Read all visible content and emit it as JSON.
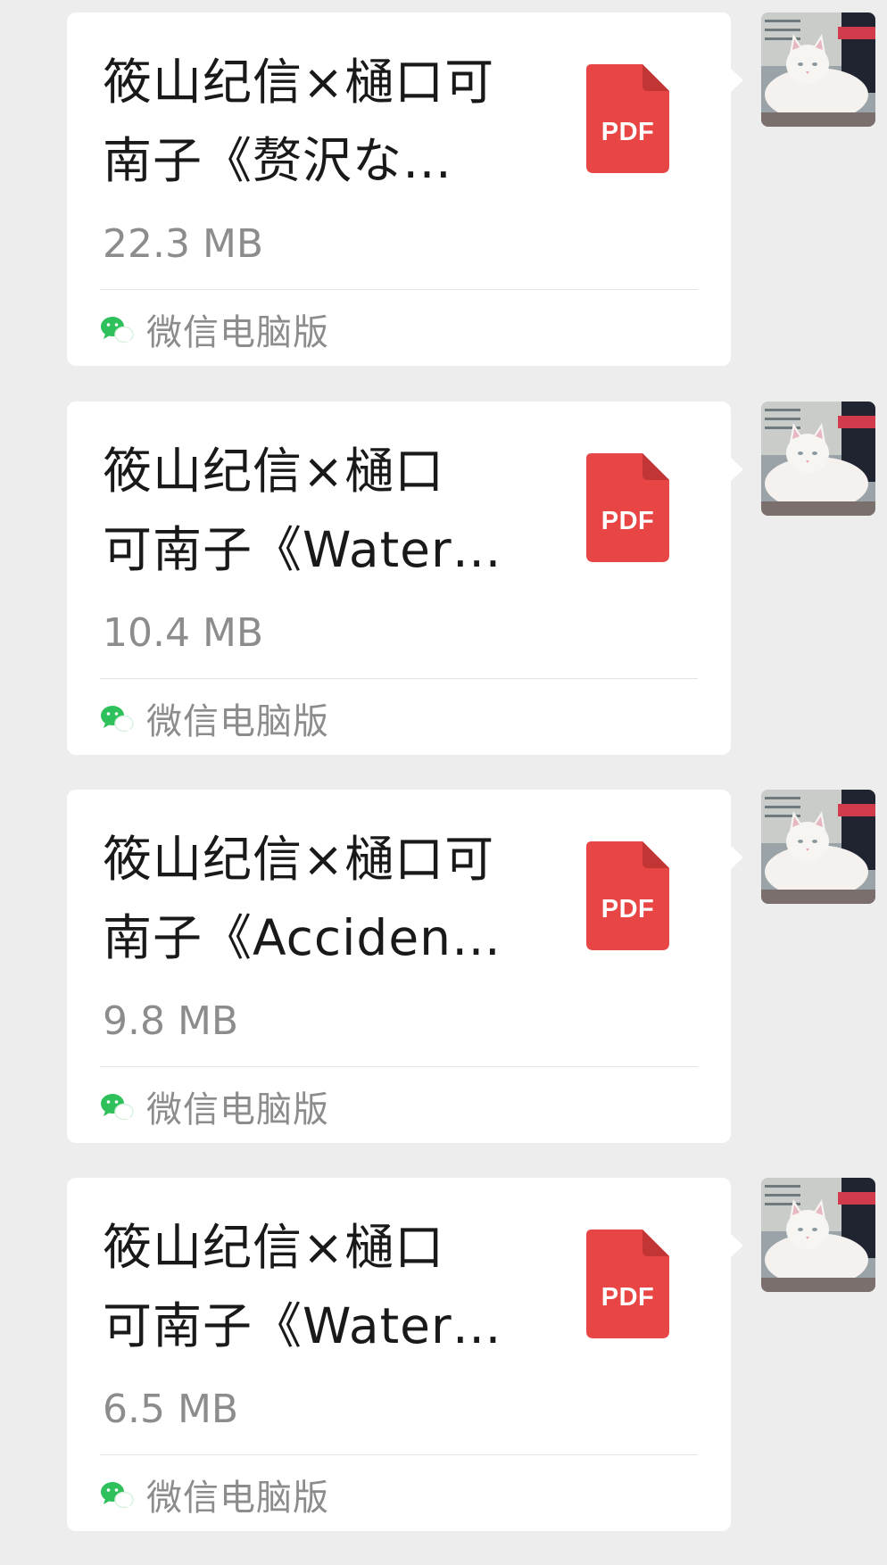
{
  "messages": [
    {
      "name_lines": [
        "筱山纪信×樋口可",
        "南子《赘沢な…"
      ],
      "size": "22.3 MB",
      "type_label": "PDF",
      "source": "微信电脑版"
    },
    {
      "name_lines": [
        "筱山纪信×樋口",
        "可南子《Water…"
      ],
      "size": "10.4 MB",
      "type_label": "PDF",
      "source": "微信电脑版"
    },
    {
      "name_lines": [
        "筱山纪信×樋口可",
        "南子《Acciden…"
      ],
      "size": "9.8 MB",
      "type_label": "PDF",
      "source": "微信电脑版"
    },
    {
      "name_lines": [
        "筱山纪信×樋口",
        "可南子《Water…"
      ],
      "size": "6.5 MB",
      "type_label": "PDF",
      "source": "微信电脑版"
    }
  ],
  "icons": {
    "file_type": "pdf-file-icon",
    "source_app": "wechat-icon",
    "avatar": "white-cat-avatar"
  },
  "colors": {
    "background": "#ededed",
    "card": "#ffffff",
    "pdf_red": "#e84545",
    "pdf_fold": "#c23535",
    "wechat_green": "#2ec05a",
    "muted_text": "#8c8c8c"
  }
}
